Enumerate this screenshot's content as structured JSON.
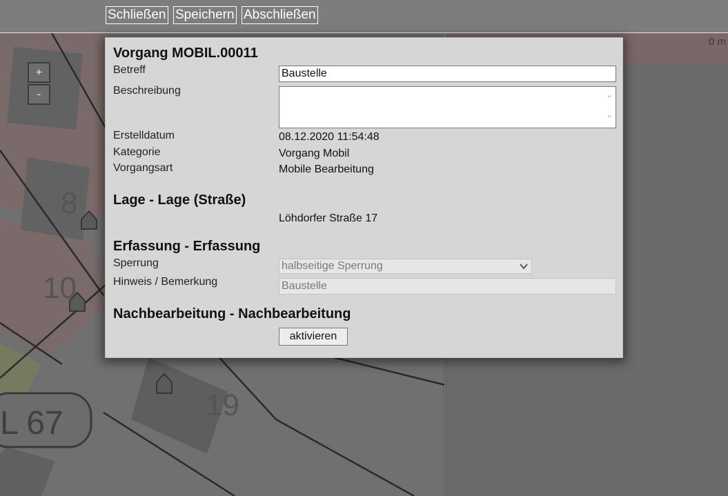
{
  "toolbar": {
    "close_label": "Schließen",
    "save_label": "Speichern",
    "finish_label": "Abschließen"
  },
  "map": {
    "zoom_in": "+",
    "zoom_out": "-",
    "scale_text": "0 m",
    "house_numbers": [
      "8",
      "10",
      "19"
    ],
    "road_label": "L 67"
  },
  "dialog": {
    "title": "Vorgang MOBIL.00011",
    "fields": {
      "betreff_label": "Betreff",
      "betreff_value": "Baustelle",
      "beschreibung_label": "Beschreibung",
      "beschreibung_value": "",
      "erstelldatum_label": "Erstelldatum",
      "erstelldatum_value": "08.12.2020 11:54:48",
      "kategorie_label": "Kategorie",
      "kategorie_value": "Vorgang Mobil",
      "vorgangsart_label": "Vorgangsart",
      "vorgangsart_value": "Mobile Bearbeitung"
    },
    "lage": {
      "heading": "Lage - Lage (Straße)",
      "address": "Löhdorfer Straße 17"
    },
    "erfassung": {
      "heading": "Erfassung - Erfassung",
      "sperrung_label": "Sperrung",
      "sperrung_value": "halbseitige Sperrung",
      "hinweis_label": "Hinweis / Bemerkung",
      "hinweis_value": "Baustelle"
    },
    "nachbearbeitung": {
      "heading": "Nachbearbeitung - Nachbearbeitung",
      "button_label": "aktivieren"
    }
  },
  "colors": {
    "overlay": "#6e6e6e",
    "toolbar": "#7d7d7d",
    "dialog_bg": "#d6d6d6"
  }
}
